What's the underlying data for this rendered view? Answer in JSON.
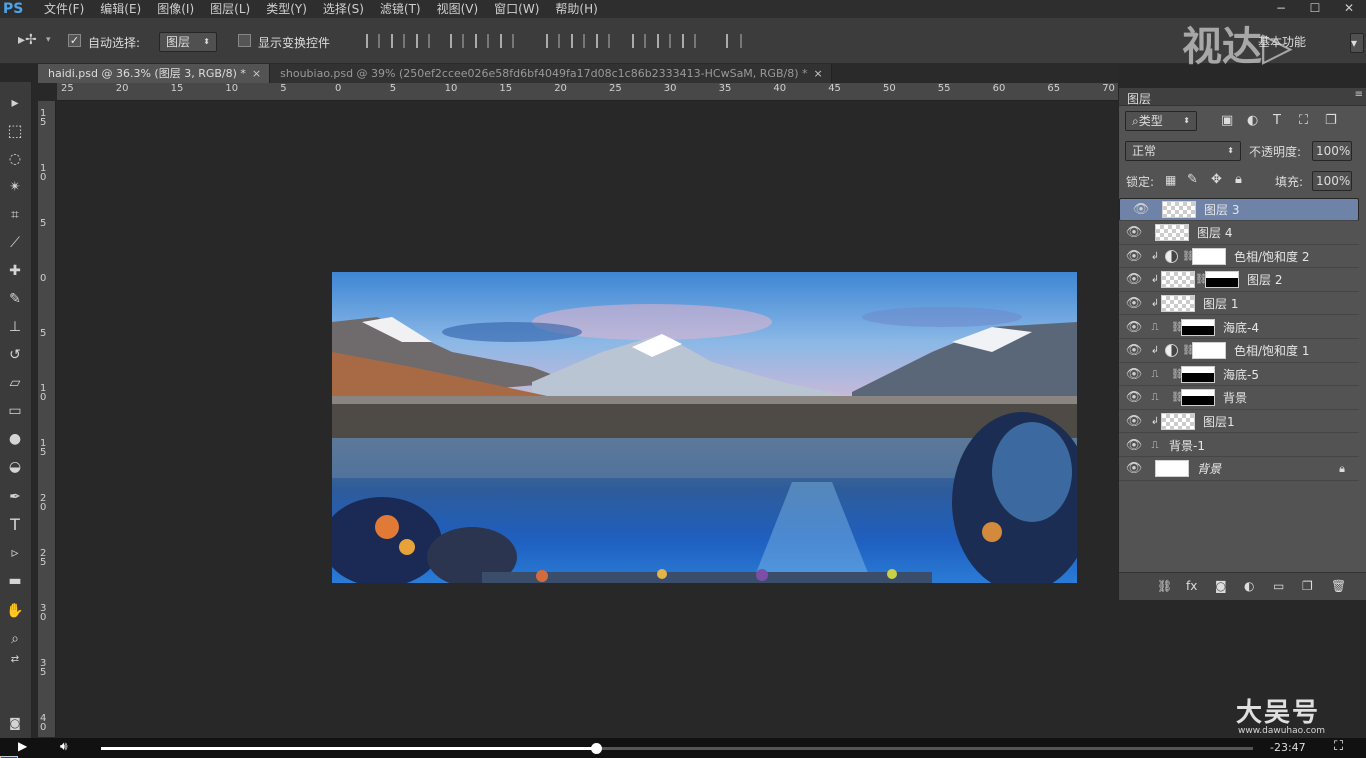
{
  "app": {
    "logo": "PS"
  },
  "menu": [
    "文件(F)",
    "编辑(E)",
    "图像(I)",
    "图层(L)",
    "类型(Y)",
    "选择(S)",
    "滤镜(T)",
    "视图(V)",
    "窗口(W)",
    "帮助(H)"
  ],
  "window_controls": [
    "−",
    "☐",
    "✕"
  ],
  "options": {
    "auto_select_label": "自动选择:",
    "auto_select_checked": true,
    "target_value": "图层",
    "transform_label": "显示变换控件",
    "transform_checked": false
  },
  "workspace": "基本功能",
  "watermarks": {
    "top": "视达▷",
    "bottom": "大吴号",
    "bottom_sub": "www.dawuhao.com"
  },
  "tabs": [
    {
      "label": "haidi.psd @ 36.3% (图层 3, RGB/8) *",
      "active": true
    },
    {
      "label": "shoubiao.psd @ 39% (250ef2ccee026e58fd6bf4049fa17d08c1c86b2333413-HCwSaM, RGB/8) *",
      "active": false
    }
  ],
  "hruler": [
    "25",
    "20",
    "15",
    "10",
    "5",
    "0",
    "5",
    "10",
    "15",
    "20",
    "25",
    "30",
    "35",
    "40",
    "45",
    "50",
    "55",
    "60",
    "65",
    "70"
  ],
  "vruler": [
    "1 5",
    "1 0",
    "5",
    "0",
    "5",
    "1 0",
    "1 5",
    "2 0",
    "2 5",
    "3 0",
    "3 5",
    "4 0"
  ],
  "tools": {
    "fg_color": "#1248a7",
    "bg_color": "#442411"
  },
  "panel": {
    "title": "图层",
    "filter_label": "类型",
    "blend_mode": "正常",
    "opacity_label": "不透明度:",
    "opacity_value": "100%",
    "lock_label": "锁定:",
    "fill_label": "填充:",
    "fill_value": "100%",
    "layers": [
      {
        "name": "图层 3",
        "type": "pixel",
        "selected": true
      },
      {
        "name": "图层 4",
        "type": "pixel"
      },
      {
        "name": "色相/饱和度 2",
        "type": "adjustment",
        "clip": true
      },
      {
        "name": "图层 2",
        "type": "masked",
        "clip": true
      },
      {
        "name": "图层 1",
        "type": "pixel",
        "clip": true
      },
      {
        "name": "海底-4",
        "type": "smart"
      },
      {
        "name": "色相/饱和度 1",
        "type": "adjustment",
        "clip": true
      },
      {
        "name": "海底-5",
        "type": "smart"
      },
      {
        "name": "背景",
        "type": "smart"
      },
      {
        "name": "图层1",
        "type": "pixel",
        "clip": true
      },
      {
        "name": "背景-1",
        "type": "smart-nothumb"
      },
      {
        "name": "背景",
        "type": "background",
        "locked": true
      }
    ],
    "footer_icons": [
      "link-icon",
      "fx-icon",
      "mask-icon",
      "adjust-icon",
      "folder-icon",
      "new-layer-icon",
      "trash-icon"
    ]
  },
  "video": {
    "time": "-23:47",
    "progress": 0.43
  }
}
